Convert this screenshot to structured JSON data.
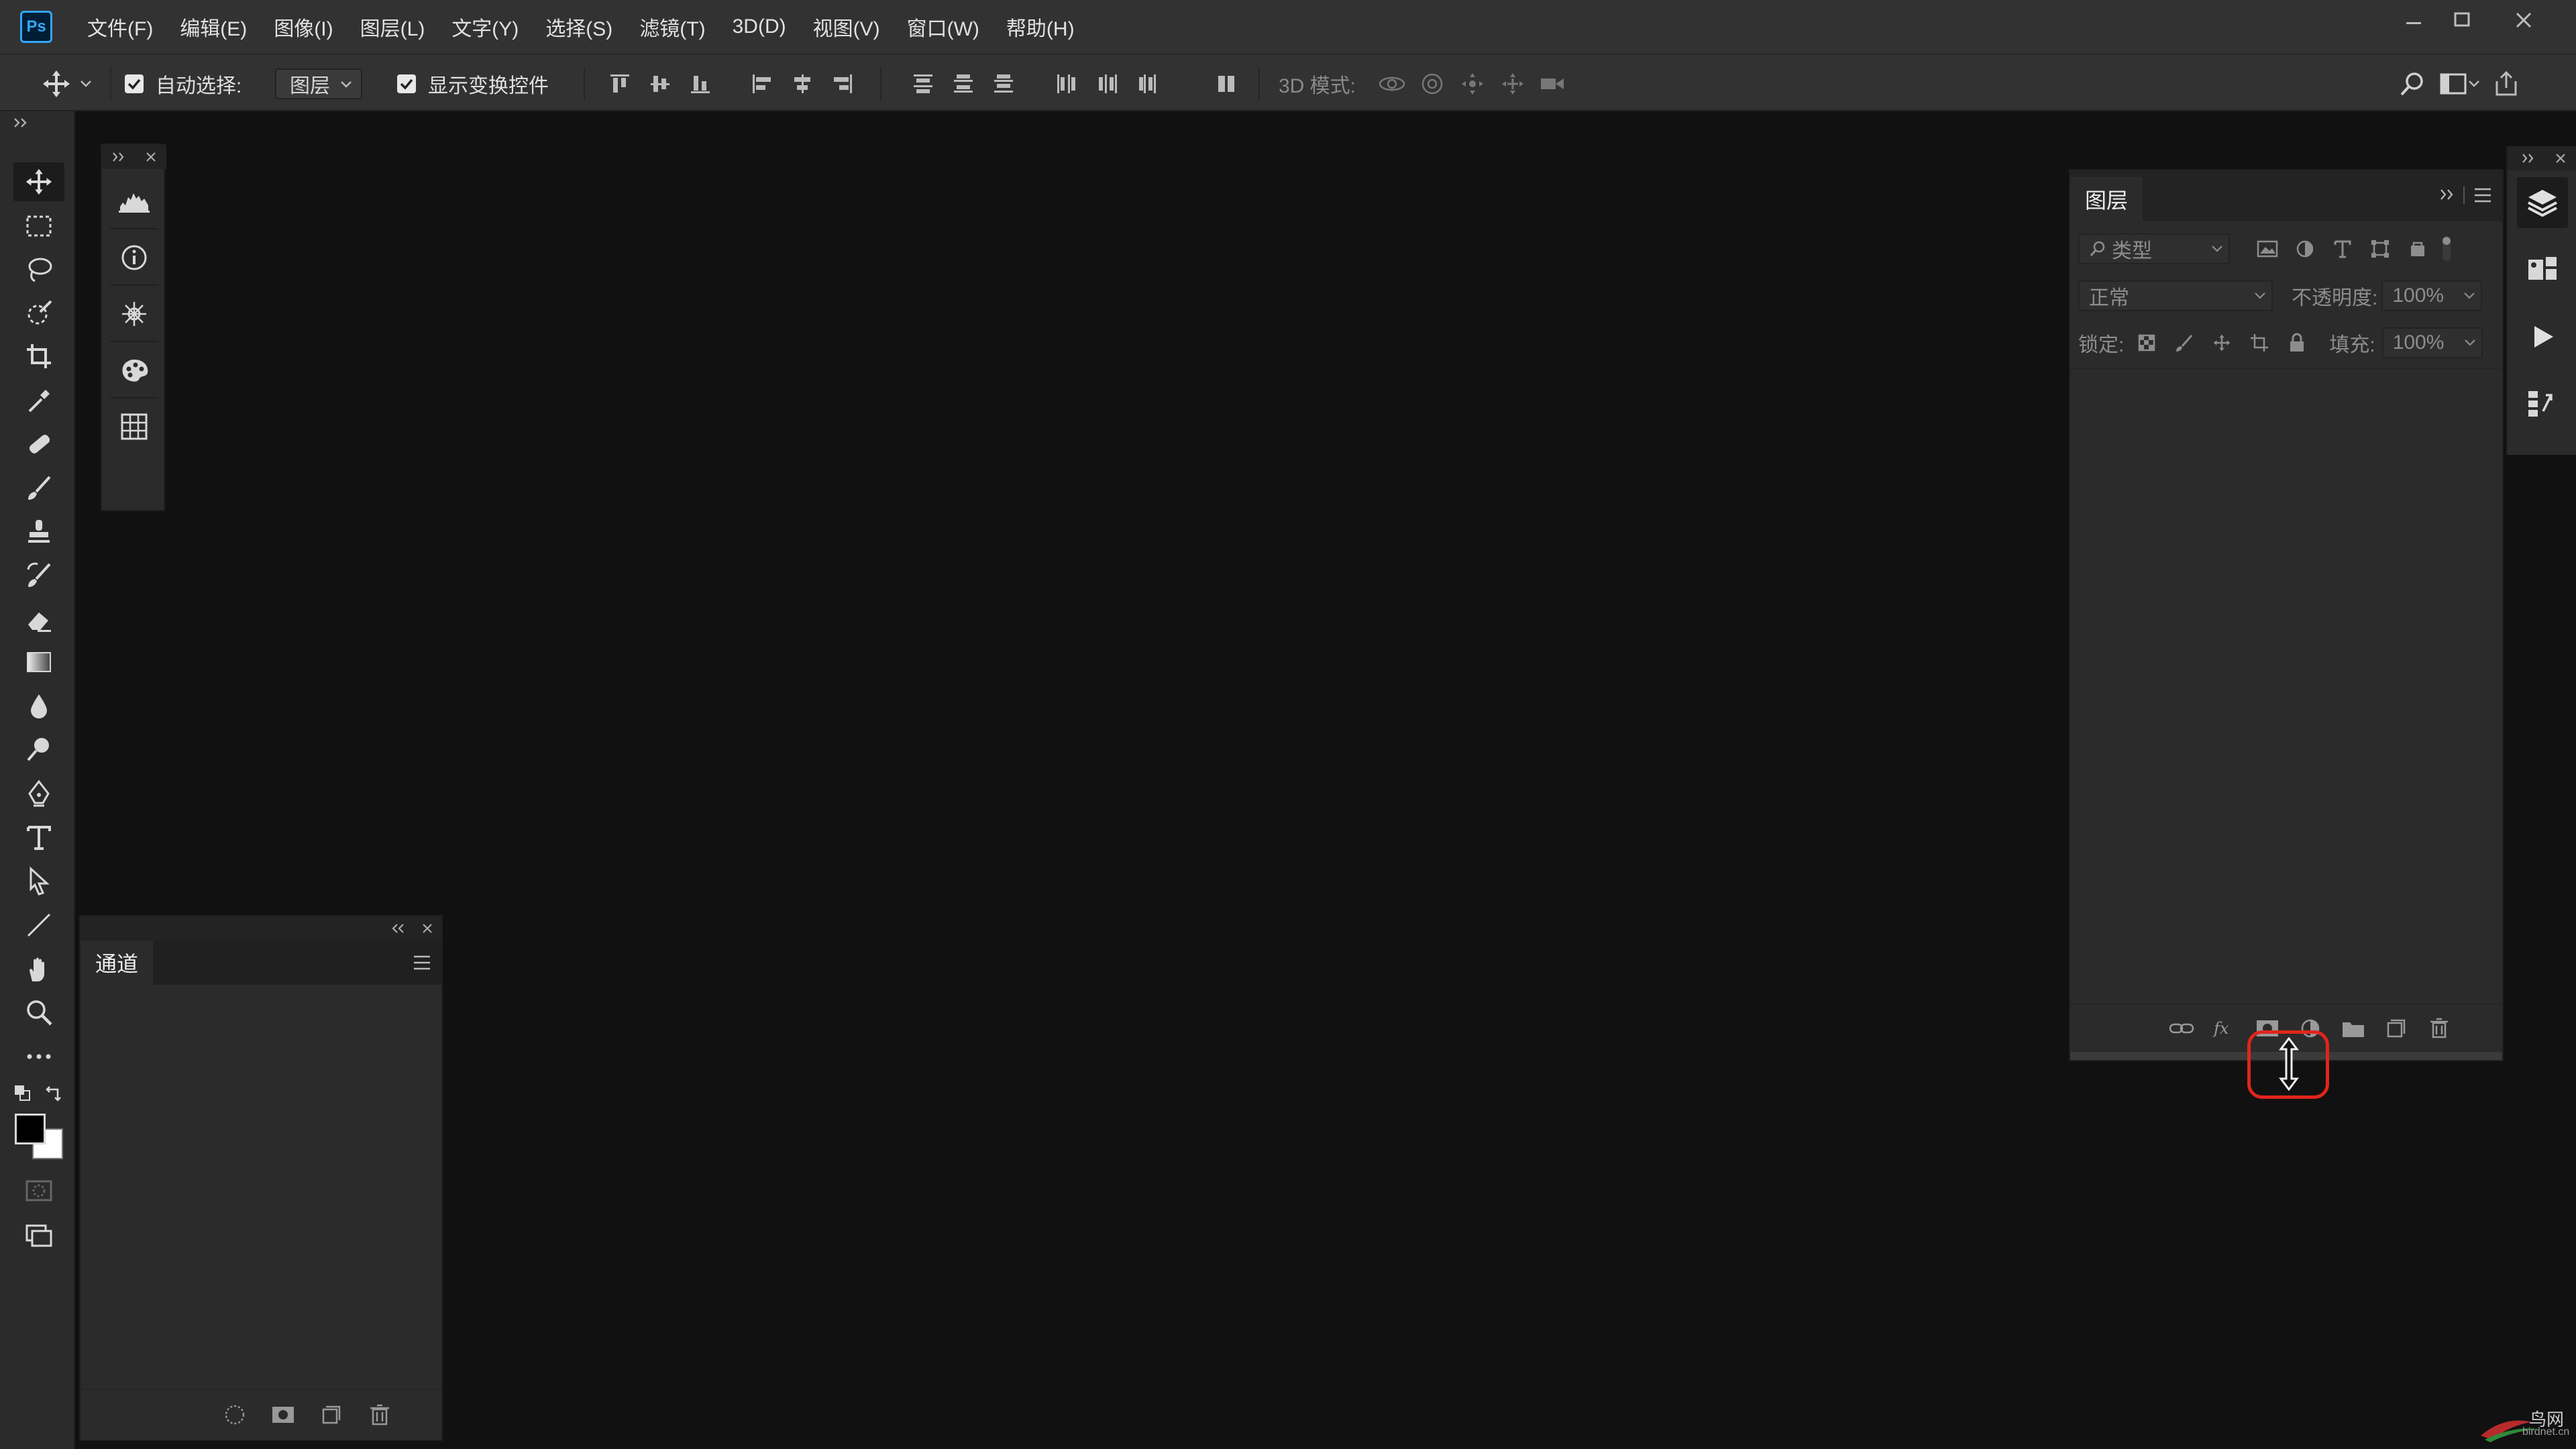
{
  "app": {
    "logo_text": "Ps",
    "accent_color": "#31a8ff",
    "highlight_color": "#e0251c"
  },
  "menu": {
    "items": [
      {
        "id": "file",
        "label": "文件(F)"
      },
      {
        "id": "edit",
        "label": "编辑(E)"
      },
      {
        "id": "image",
        "label": "图像(I)"
      },
      {
        "id": "layer",
        "label": "图层(L)"
      },
      {
        "id": "type",
        "label": "文字(Y)"
      },
      {
        "id": "select",
        "label": "选择(S)"
      },
      {
        "id": "filter",
        "label": "滤镜(T)"
      },
      {
        "id": "3d",
        "label": "3D(D)"
      },
      {
        "id": "view",
        "label": "视图(V)"
      },
      {
        "id": "window",
        "label": "窗口(W)"
      },
      {
        "id": "help",
        "label": "帮助(H)"
      }
    ]
  },
  "options": {
    "auto_select_label": "自动选择:",
    "auto_select_checked": true,
    "auto_select_target": "图层",
    "show_transform_label": "显示变换控件",
    "show_transform_checked": true,
    "mode_3d_label": "3D 模式:"
  },
  "toolbar": {
    "tools": [
      {
        "name": "move-tool",
        "icon": "move-icon",
        "active": true
      },
      {
        "name": "marquee-tool",
        "icon": "rect-marquee-icon"
      },
      {
        "name": "lasso-tool",
        "icon": "lasso-icon"
      },
      {
        "name": "quick-select-tool",
        "icon": "quick-select-icon"
      },
      {
        "name": "crop-tool",
        "icon": "crop-icon"
      },
      {
        "name": "eyedropper-tool",
        "icon": "eyedropper-icon"
      },
      {
        "name": "healing-tool",
        "icon": "bandage-icon"
      },
      {
        "name": "brush-tool",
        "icon": "brush-icon"
      },
      {
        "name": "stamp-tool",
        "icon": "stamp-icon"
      },
      {
        "name": "history-brush-tool",
        "icon": "history-brush-icon"
      },
      {
        "name": "eraser-tool",
        "icon": "eraser-icon"
      },
      {
        "name": "gradient-tool",
        "icon": "gradient-icon"
      },
      {
        "name": "blur-tool",
        "icon": "drop-icon"
      },
      {
        "name": "dodge-tool",
        "icon": "dodge-icon"
      },
      {
        "name": "pen-tool",
        "icon": "pen-icon"
      },
      {
        "name": "type-tool",
        "icon": "type-icon"
      },
      {
        "name": "path-select-tool",
        "icon": "arrow-icon"
      },
      {
        "name": "line-tool",
        "icon": "line-icon"
      },
      {
        "name": "hand-tool",
        "icon": "hand-icon"
      },
      {
        "name": "zoom-tool",
        "icon": "magnifier-icon"
      },
      {
        "name": "more-tools",
        "icon": "ellipsis-icon"
      }
    ]
  },
  "mini_panel": {
    "buttons": [
      "histogram-icon",
      "info-icon",
      "navigator-icon",
      "color-palette-icon",
      "grid-icon"
    ]
  },
  "channels": {
    "tab_label": "通道"
  },
  "layers": {
    "tab_label": "图层",
    "filter_placeholder": "类型",
    "blend_mode": "正常",
    "opacity_label": "不透明度:",
    "opacity_value": "100%",
    "lock_label": "锁定:",
    "fill_label": "填充:",
    "fill_value": "100%"
  },
  "watermark": {
    "text": "鸟网",
    "sub": "birdnet.cn"
  }
}
